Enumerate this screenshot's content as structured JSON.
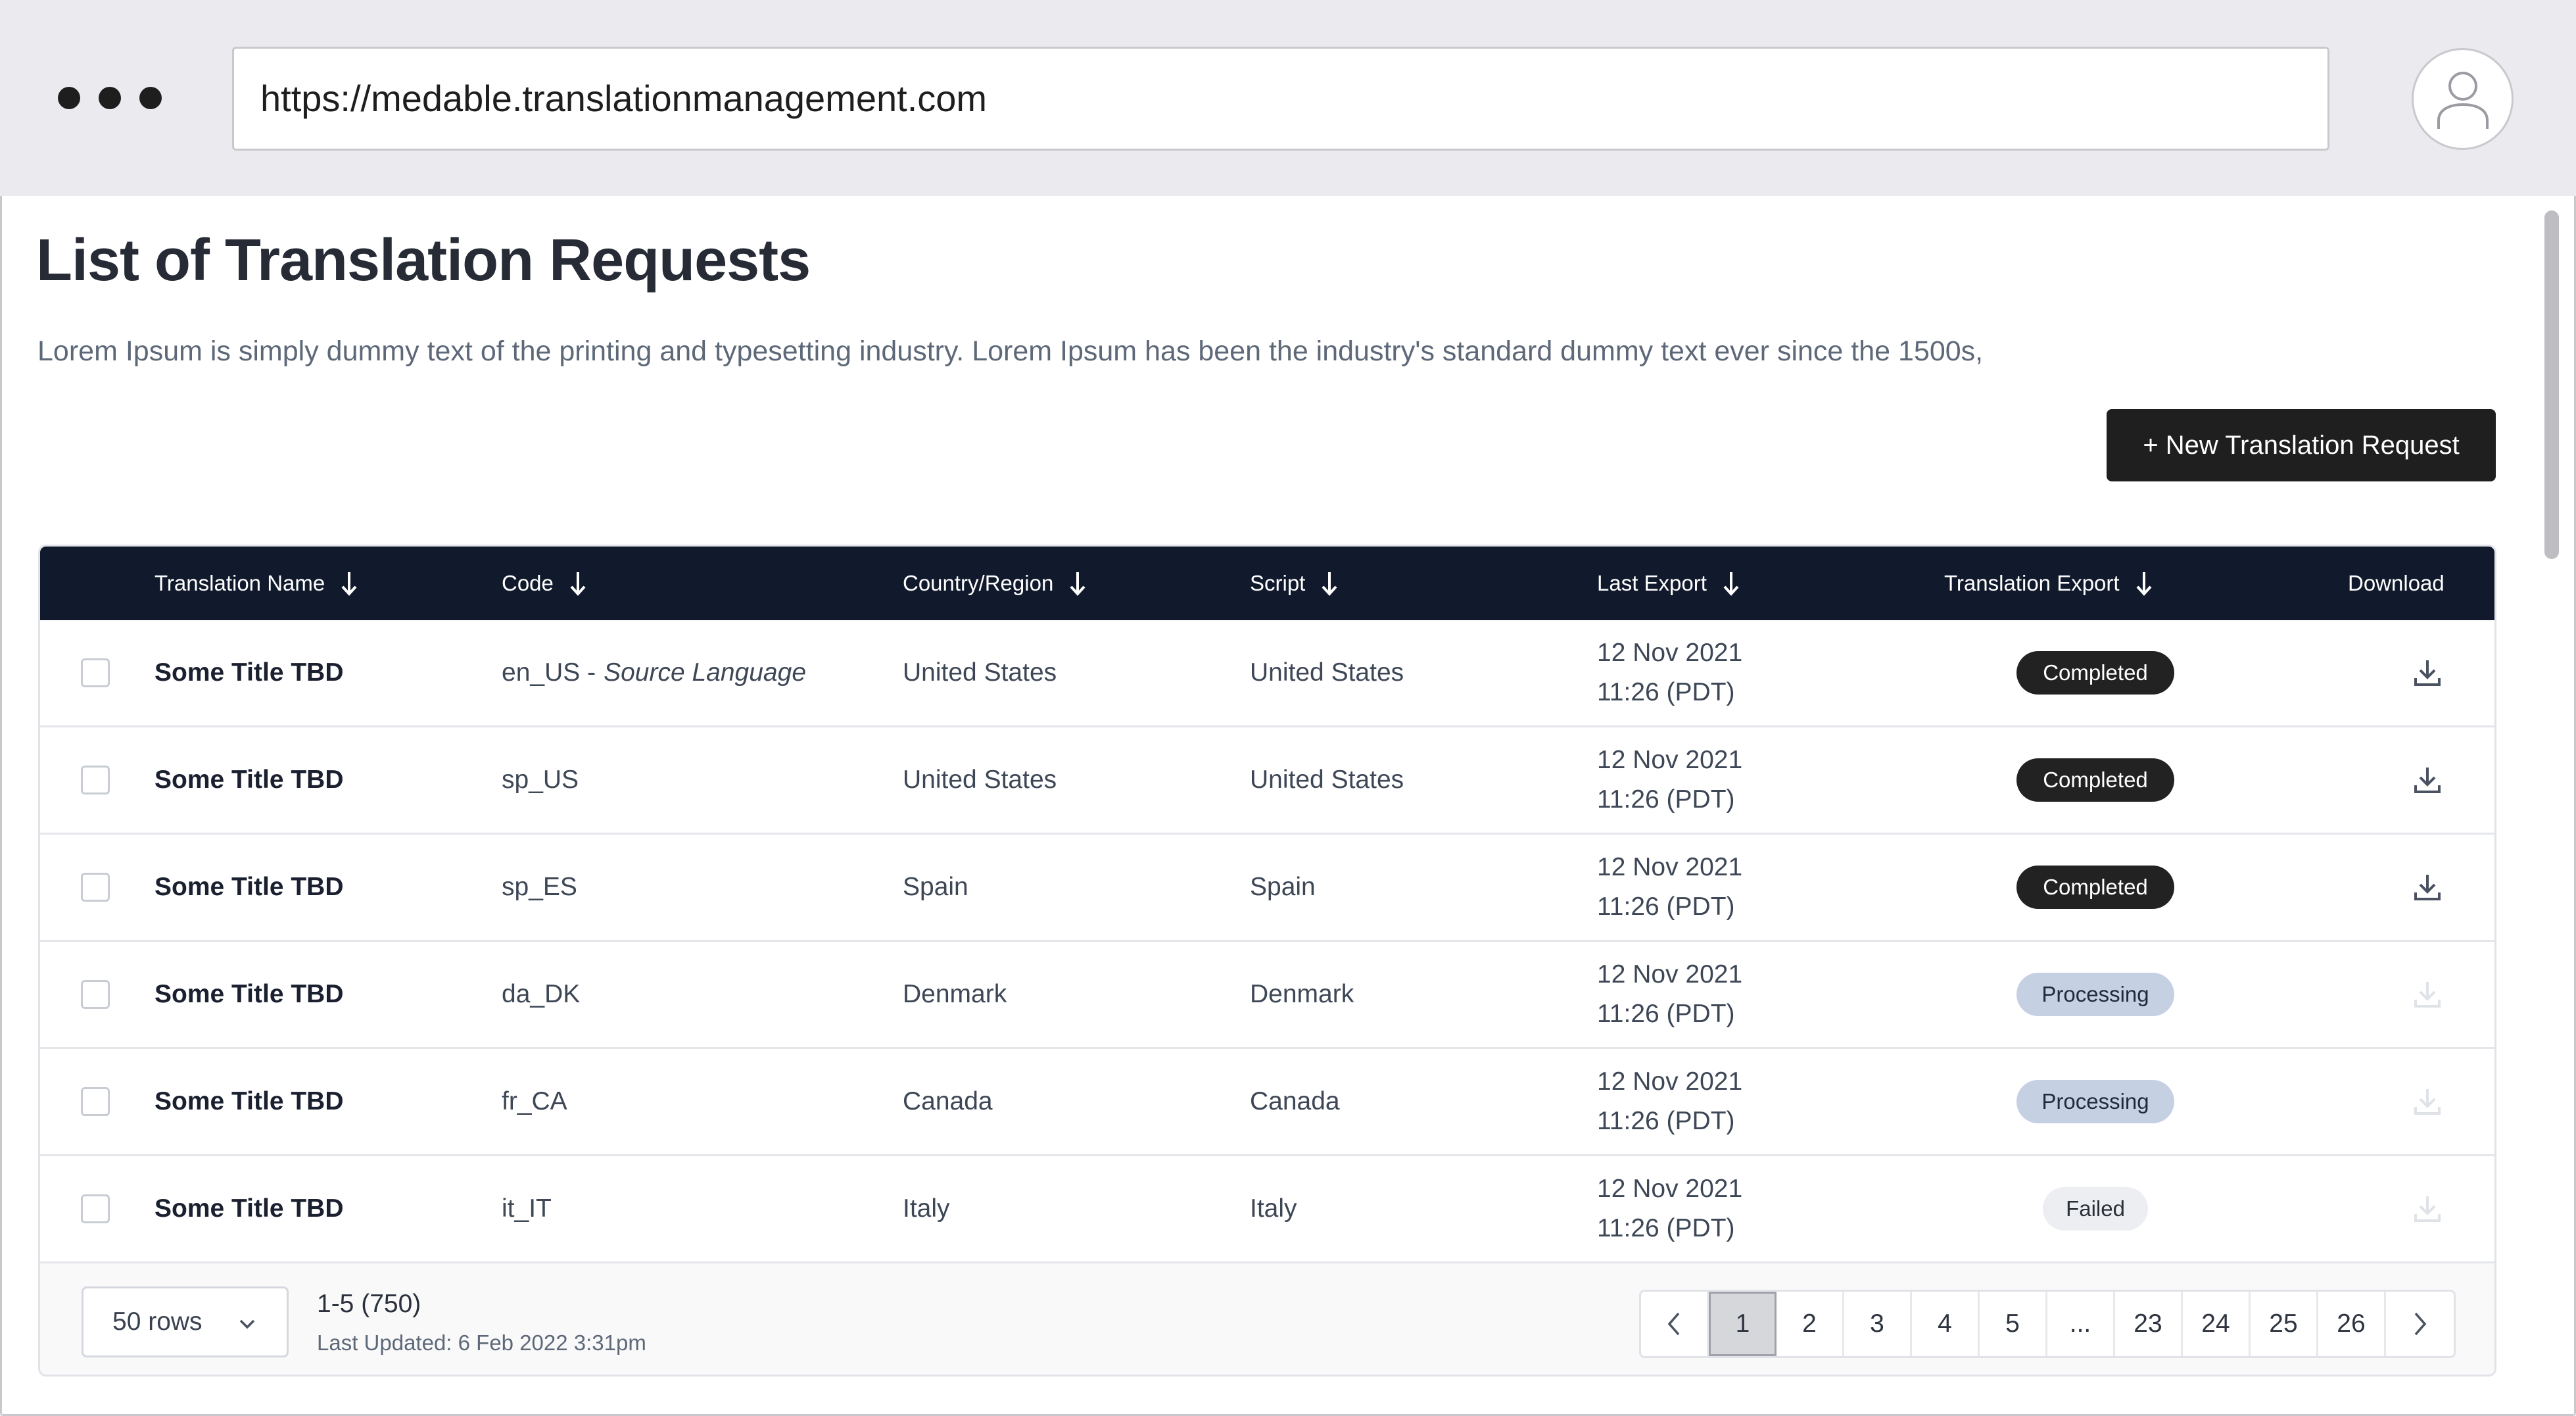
{
  "browser": {
    "url": "https://medable.translationmanagement.com",
    "menu_icon": "ellipsis-icon",
    "avatar_icon": "user-icon"
  },
  "page": {
    "title": "List of Translation Requests",
    "description": "Lorem Ipsum is simply dummy text of the printing and typesetting industry. Lorem Ipsum has been the industry's standard dummy text ever since the 1500s,",
    "new_button_label": "+ New Translation Request"
  },
  "table": {
    "headers": {
      "name": "Translation Name",
      "code": "Code",
      "country": "Country/Region",
      "script": "Script",
      "last_export": "Last Export",
      "translation_export": "Translation Export",
      "download": "Download"
    },
    "rows": [
      {
        "name": "Some Title TBD",
        "code": "en_US -",
        "code_note": "Source Language",
        "country": "United States",
        "script": "United States",
        "date": "12 Nov 2021",
        "time": "11:26 (PDT)",
        "status": "Completed",
        "status_type": "completed",
        "download_enabled": true
      },
      {
        "name": "Some Title TBD",
        "code": "sp_US",
        "code_note": "",
        "country": "United States",
        "script": "United States",
        "date": "12 Nov 2021",
        "time": "11:26 (PDT)",
        "status": "Completed",
        "status_type": "completed",
        "download_enabled": true
      },
      {
        "name": "Some Title TBD",
        "code": "sp_ES",
        "code_note": "",
        "country": "Spain",
        "script": "Spain",
        "date": "12 Nov 2021",
        "time": "11:26 (PDT)",
        "status": "Completed",
        "status_type": "completed",
        "download_enabled": true
      },
      {
        "name": "Some Title TBD",
        "code": "da_DK",
        "code_note": "",
        "country": "Denmark",
        "script": "Denmark",
        "date": "12 Nov 2021",
        "time": "11:26 (PDT)",
        "status": "Processing",
        "status_type": "processing",
        "download_enabled": false
      },
      {
        "name": "Some Title TBD",
        "code": "fr_CA",
        "code_note": "",
        "country": "Canada",
        "script": "Canada",
        "date": "12 Nov 2021",
        "time": "11:26 (PDT)",
        "status": "Processing",
        "status_type": "processing",
        "download_enabled": false
      },
      {
        "name": "Some Title TBD",
        "code": "it_IT",
        "code_note": "",
        "country": "Italy",
        "script": "Italy",
        "date": "12 Nov 2021",
        "time": "11:26 (PDT)",
        "status": "Failed",
        "status_type": "failed",
        "download_enabled": false
      }
    ]
  },
  "footer": {
    "rows_per_page": "50 rows",
    "range": "1-5 (750)",
    "last_updated": "Last Updated: 6 Feb 2022 3:31pm",
    "pages": [
      "1",
      "2",
      "3",
      "4",
      "5",
      "...",
      "23",
      "24",
      "25",
      "26"
    ],
    "current_page": "1"
  },
  "colors": {
    "header_bg": "#111a2c",
    "completed": "#222222",
    "processing": "#c5d0e3",
    "failed": "#eceef1",
    "button": "#1f1f1f"
  }
}
